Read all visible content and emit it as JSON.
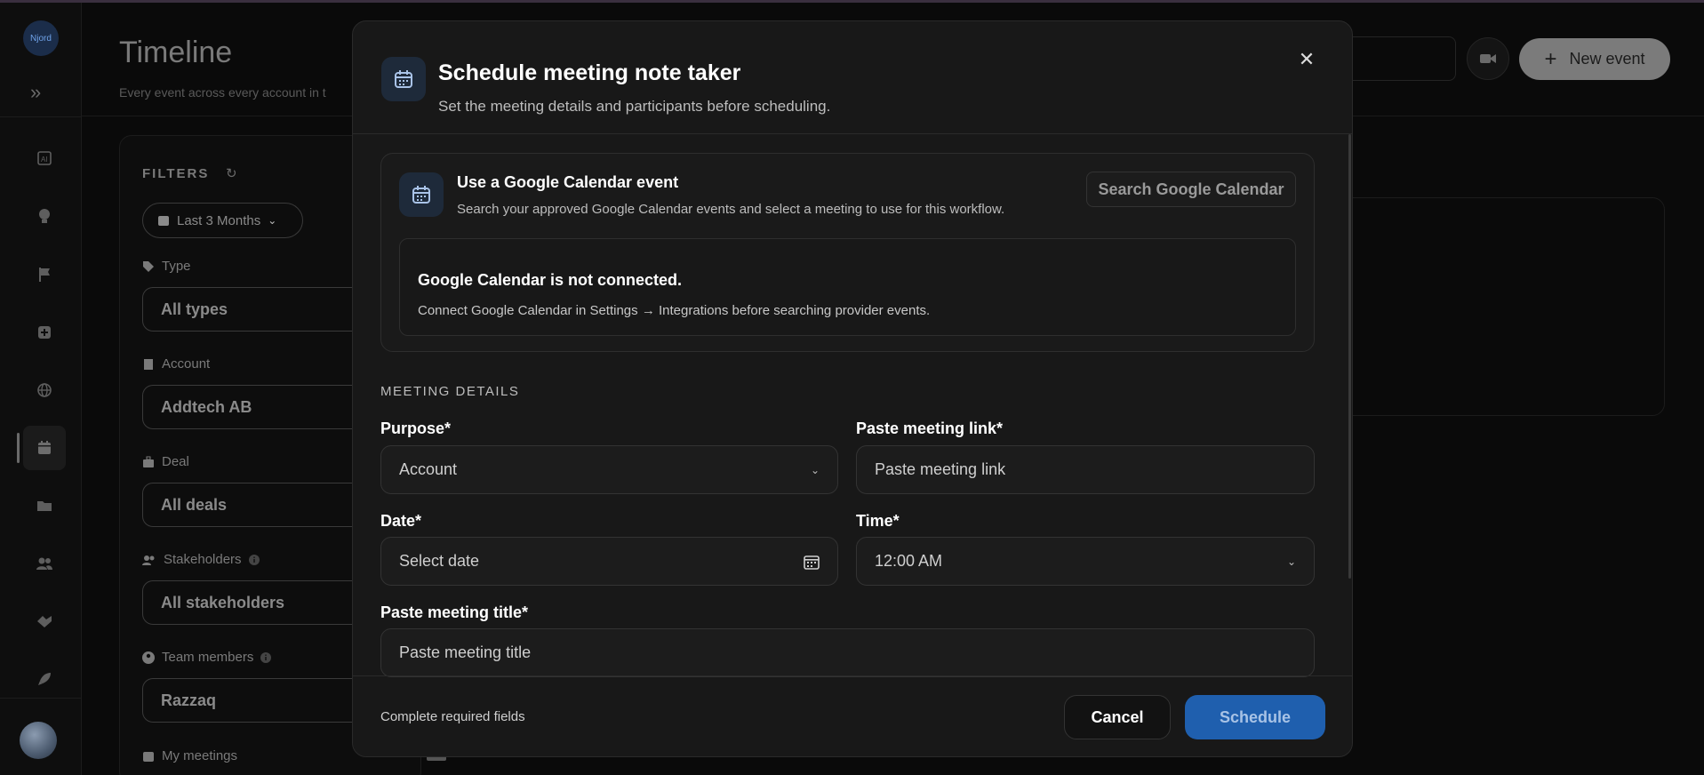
{
  "sidebar": {
    "logo_text": "Njord",
    "expand_glyph": "»",
    "items": [
      {
        "name": "ai-icon"
      },
      {
        "name": "lightbulb-icon"
      },
      {
        "name": "flag-icon"
      },
      {
        "name": "add-box-icon"
      },
      {
        "name": "globe-icon"
      },
      {
        "name": "calendar-icon",
        "active": true
      },
      {
        "name": "folder-icon"
      },
      {
        "name": "people-icon"
      },
      {
        "name": "handshake-icon"
      },
      {
        "name": "rocket-icon"
      }
    ]
  },
  "page": {
    "title": "Timeline",
    "subtitle": "Every event across every account in t",
    "new_event_label": "New event",
    "plus_glyph": "+"
  },
  "filters": {
    "title": "FILTERS",
    "reset_glyph": "↻",
    "date_range": "Last 3 Months",
    "type_label": "Type",
    "type_value": "All types",
    "account_label": "Account",
    "account_value": "Addtech AB",
    "deal_label": "Deal",
    "deal_value": "All deals",
    "stakeholders_label": "Stakeholders",
    "stakeholders_value": "All stakeholders",
    "team_label": "Team members",
    "team_value": "Razzaq",
    "my_meetings_label": "My meetings"
  },
  "modal": {
    "title": "Schedule meeting note taker",
    "subtitle": "Set the meeting details and participants before scheduling.",
    "close_glyph": "✕",
    "gcal": {
      "title": "Use a Google Calendar event",
      "description": "Search your approved Google Calendar events and select a meeting to use for this workflow.",
      "search_label": "Search Google Calendar",
      "notice_title": "Google Calendar is not connected.",
      "notice_desc": "Connect Google Calendar in Settings → Integrations before searching provider events."
    },
    "section_label": "MEETING DETAILS",
    "purpose_label": "Purpose*",
    "purpose_value": "Account",
    "link_label": "Paste meeting link*",
    "link_placeholder": "Paste meeting link",
    "date_label": "Date*",
    "date_placeholder": "Select date",
    "time_label": "Time*",
    "time_value": "12:00 AM",
    "title_label": "Paste meeting title*",
    "title_placeholder": "Paste meeting title",
    "footer_text": "Complete required fields",
    "cancel_label": "Cancel",
    "schedule_label": "Schedule",
    "chevron_glyph": "⌄"
  },
  "colors": {
    "accent": "#1f5fae",
    "background": "#0a0a0a",
    "modal_bg": "#181818"
  }
}
